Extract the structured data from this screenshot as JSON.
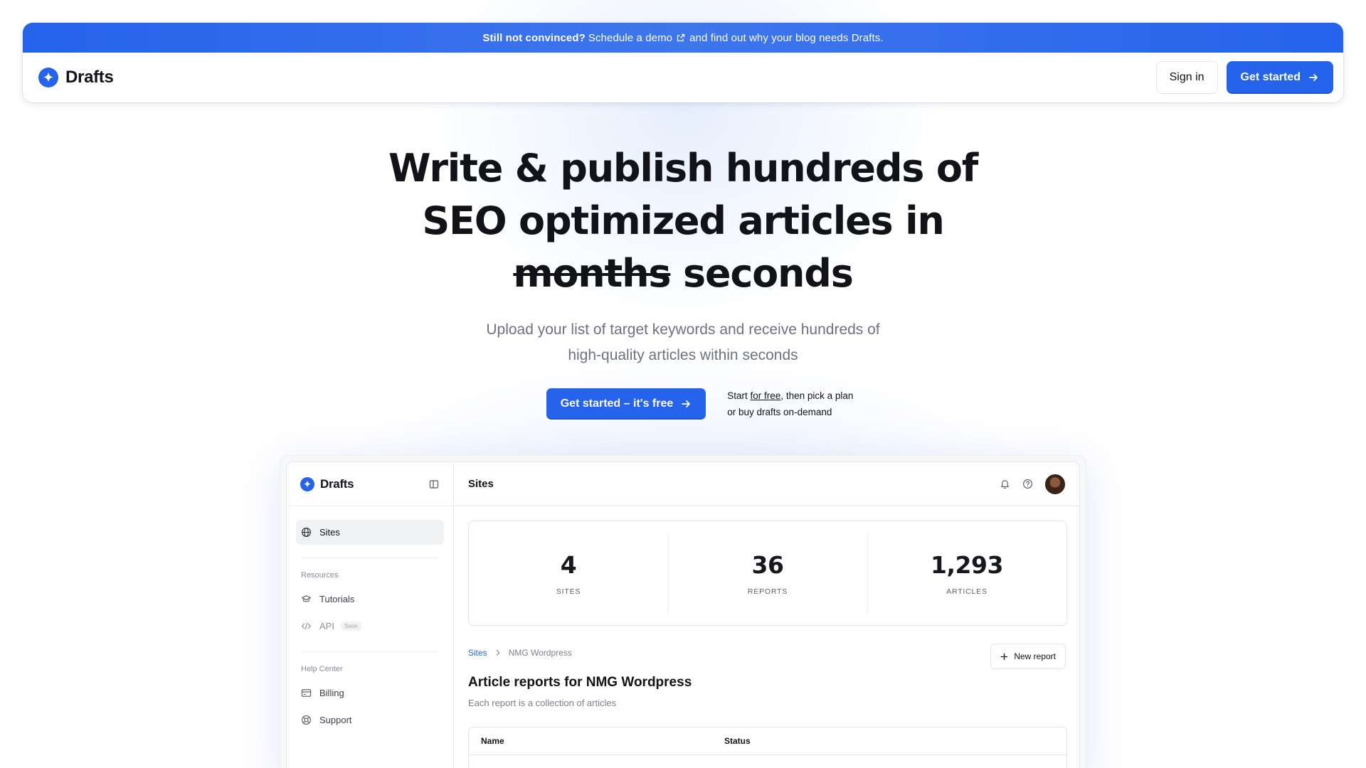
{
  "announcement": {
    "bold": "Still not convinced?",
    "link": "Schedule a demo",
    "rest": "and find out why your blog needs Drafts."
  },
  "nav": {
    "brand": "Drafts",
    "sign_in": "Sign in",
    "get_started": "Get started"
  },
  "hero": {
    "line1": "Write & publish hundreds of",
    "line2": "SEO optimized articles in",
    "struck": "months",
    "replacement": "seconds",
    "subtitle_line1": "Upload your list of target keywords and receive hundreds of",
    "subtitle_line2": "high-quality articles within seconds",
    "cta": "Get started – it's free",
    "note_start": "Start",
    "note_link": "for free",
    "note_rest": ", then pick a plan",
    "note_line2": "or buy drafts on-demand"
  },
  "app": {
    "brand": "Drafts",
    "page_title": "Sites",
    "sidebar": {
      "sites": "Sites",
      "resources_label": "Resources",
      "tutorials": "Tutorials",
      "api": "API",
      "api_badge": "Soon",
      "help_label": "Help Center",
      "billing": "Billing",
      "support": "Support"
    },
    "stats": [
      {
        "value": "4",
        "label": "SITES"
      },
      {
        "value": "36",
        "label": "REPORTS"
      },
      {
        "value": "1,293",
        "label": "ARTICLES"
      }
    ],
    "breadcrumb": {
      "root": "Sites",
      "current": "NMG Wordpress"
    },
    "new_report": "New report",
    "report_title": "Article reports for NMG Wordpress",
    "report_subtitle": "Each report is a collection of articles",
    "table_headers": {
      "name": "Name",
      "status": "Status"
    }
  },
  "colors": {
    "accent": "#2563eb",
    "text": "#111318",
    "muted": "#6b7280"
  },
  "icons": [
    "sparkle-logo-icon",
    "external-link-icon",
    "arrow-right-icon",
    "sidebar-toggle-icon",
    "globe-icon",
    "graduation-cap-icon",
    "code-icon",
    "credit-card-icon",
    "lifebuoy-icon",
    "bell-icon",
    "help-circle-icon",
    "chevron-right-icon",
    "plus-icon"
  ]
}
